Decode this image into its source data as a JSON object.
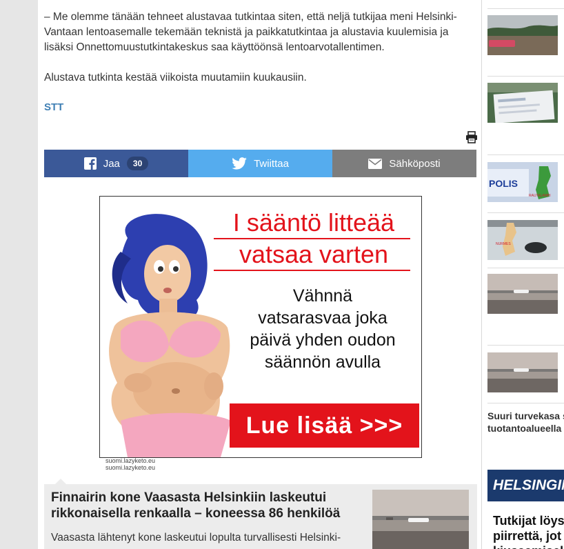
{
  "article": {
    "paragraph_1_line_1": "– Me olemme tänään tehneet alustavaa tutkintaa siten, että neljä tutkijaa meni Helsinki-",
    "paragraph_1_line_2": "Vantaan lentoasemalle tekemään teknistä ja paikkatutkintaa ja alustavia kuulemisia ja",
    "paragraph_1_line_3": "lisäksi Onnettomuustutkintakeskus saa käyttöönsä lentoarvotallentimen.",
    "paragraph_2": "Alustava tutkinta kestää viikoista muutamiin kuukausiin.",
    "source": "STT"
  },
  "toolbar": {
    "print_icon": "printer-icon"
  },
  "share": {
    "facebook": {
      "label": "Jaa",
      "count": "30",
      "icon": "facebook-icon",
      "color": "#3b5998"
    },
    "twitter": {
      "label": "Twiittaa",
      "icon": "twitter-icon",
      "color": "#55acee"
    },
    "email": {
      "label": "Sähköposti",
      "icon": "envelope-icon",
      "color": "#7d7d7d"
    }
  },
  "ad": {
    "headline_line_1": "I sääntö litteää",
    "headline_line_2": "vatsaa varten",
    "body_line_1": "Vähnnä",
    "body_line_2": "vatsarasvaa joka",
    "body_line_3": "päivä yhden oudon",
    "body_line_4": "säännön avulla",
    "cta": "Lue lisää >>>",
    "domain_line_1": "suomi.lazyketo.eu",
    "domain_line_2": "suomi.lazyketo.eu",
    "accent_color": "#e3131b"
  },
  "related": {
    "title_line_1": "Finnairin kone Vaasasta Helsinkiin laskeutui",
    "title_line_2": "rikkonaisella renkaalla – koneessa 86 henkilöä",
    "description": "Vaasasta lähtenyt kone laskeutui lopulta turvallisesti Helsinki-"
  },
  "sidebar": {
    "thumb_caption_line_1": "Suuri turvekasa sy",
    "thumb_caption_line_2": "tuotantoalueella l",
    "thumb_map_label_1": "RAUTALAMPI",
    "thumb_map_label_2": "NURMES",
    "banner": "HELSINGIN",
    "news_line_1": "Tutkijat löys",
    "news_line_2": "piirrettä, jot",
    "news_line_3": "kiusaamisell"
  }
}
